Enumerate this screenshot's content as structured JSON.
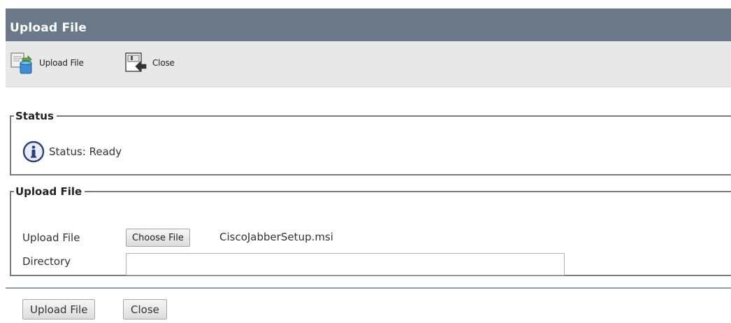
{
  "window": {
    "title": "Upload File"
  },
  "toolbar": {
    "items": [
      {
        "label": "Upload File",
        "icon": "upload-file-icon"
      },
      {
        "label": "Close",
        "icon": "close-icon"
      }
    ]
  },
  "status_section": {
    "legend": "Status",
    "icon": "info-icon",
    "text": "Status: Ready"
  },
  "upload_section": {
    "legend": "Upload File",
    "upload_label": "Upload File",
    "choose_button": "Choose File",
    "chosen_file": "CiscoJabberSetup.msi",
    "directory_label": "Directory",
    "directory_value": ""
  },
  "footer": {
    "upload_button": "Upload File",
    "close_button": "Close"
  },
  "colors": {
    "title_bar": "#6b7888",
    "toolbar_bg": "#e8e8e8",
    "divider": "#8aa0b0"
  }
}
